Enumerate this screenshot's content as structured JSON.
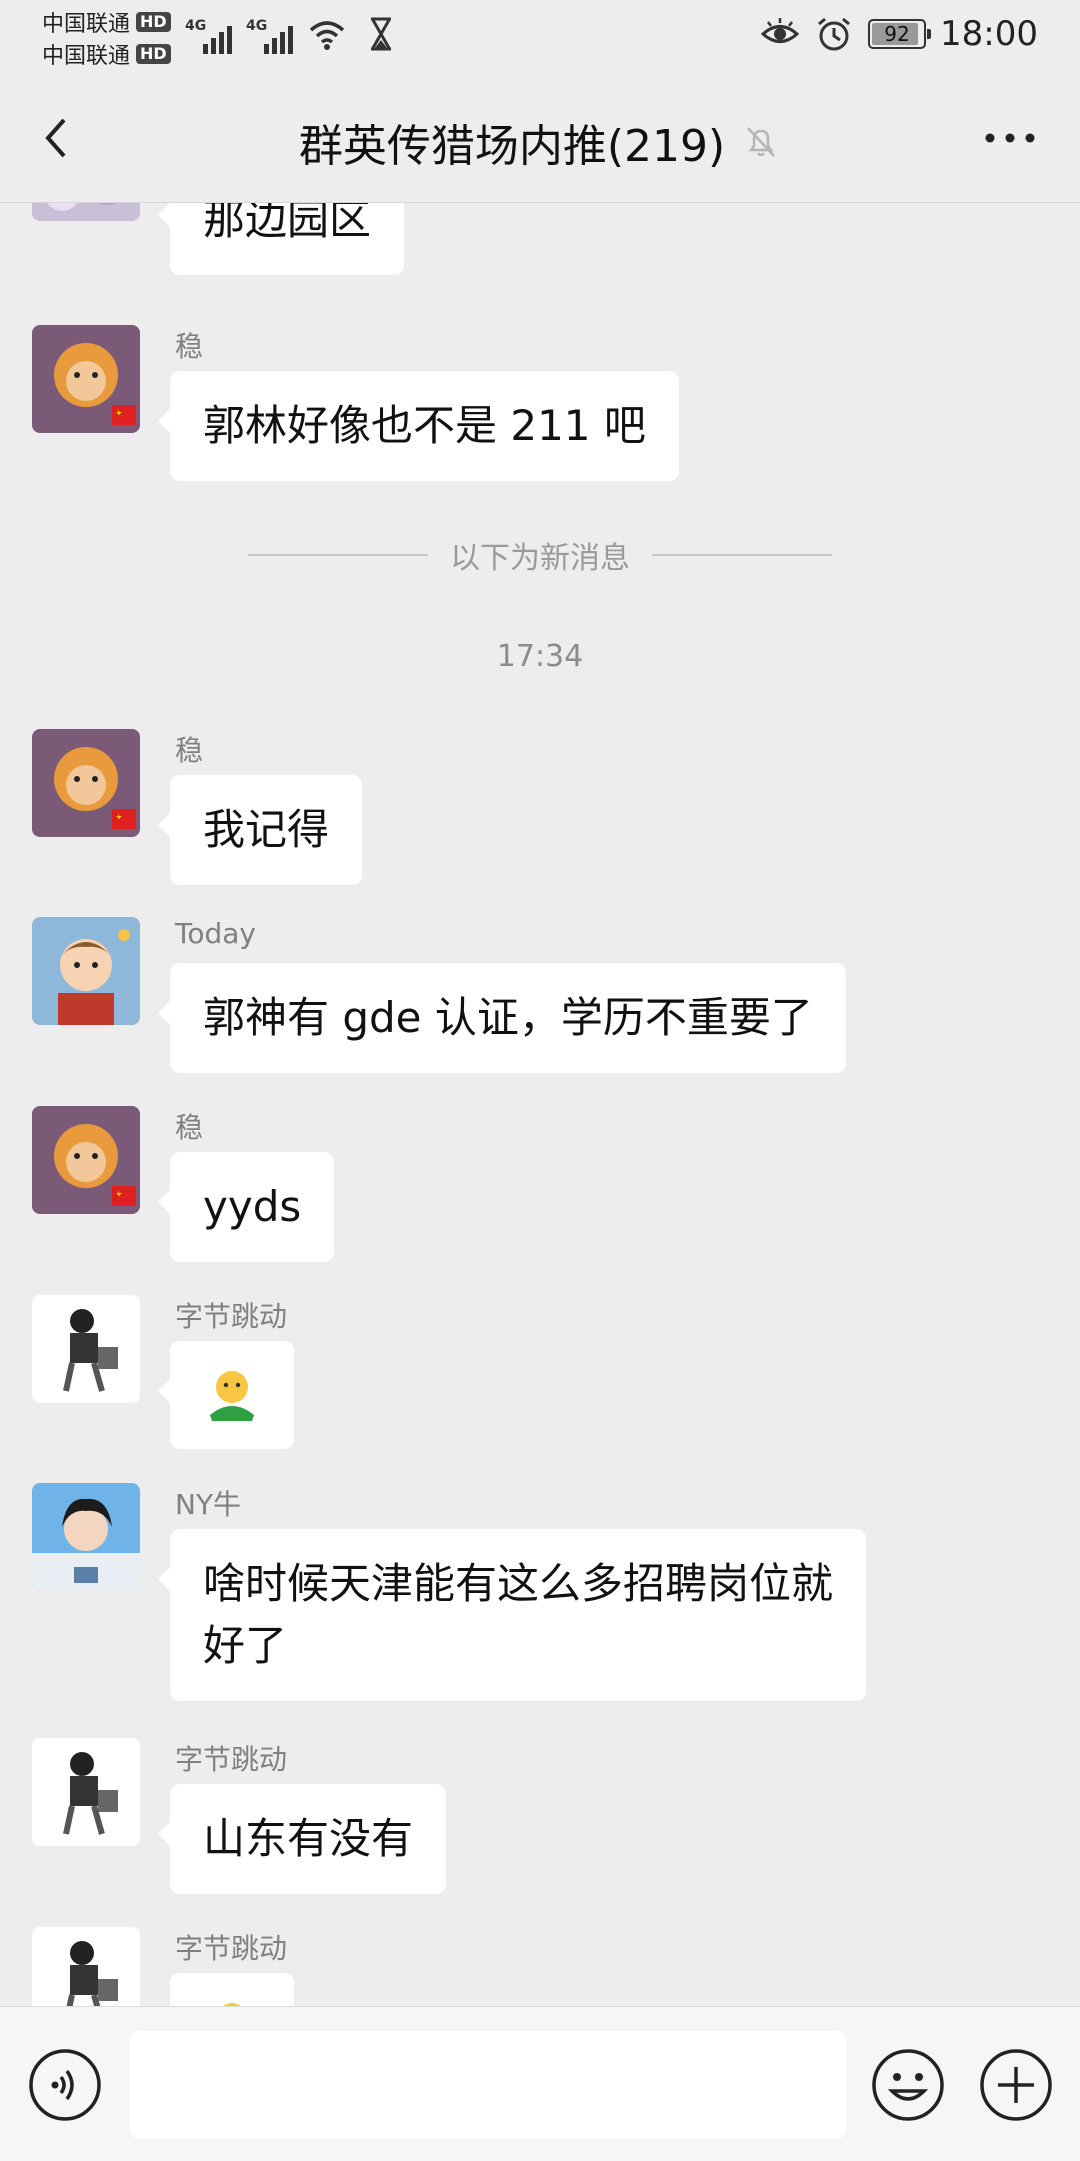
{
  "status_bar": {
    "carrier_1": "中国联通",
    "carrier_2": "中国联通",
    "hd": "HD",
    "network_1": "4G",
    "network_2": "4G",
    "battery_level": "92",
    "battery_fraction": 0.92,
    "time": "18:00"
  },
  "header": {
    "title": "群英传猎场内推(219)",
    "back_icon": "back-arrow",
    "mute_icon": "bell-muted",
    "more_icon": "more-dots"
  },
  "chat": {
    "new_messages_divider": "以下为新消息",
    "timestamp": "17:34",
    "messages": [
      {
        "sender": "",
        "text": "那边园区"
      },
      {
        "sender": "稳",
        "text": "郭林好像也不是 211 吧"
      },
      {
        "sender": "稳",
        "text": "我记得"
      },
      {
        "sender": "Today",
        "text": "郭神有 gde 认证，学历不重要了"
      },
      {
        "sender": "稳",
        "text": "yyds"
      },
      {
        "sender": "字节跳动",
        "text": "",
        "sticker": "green-shirt-emoji"
      },
      {
        "sender": "NY牛",
        "text_line1": "啥时候天津能有这么多招聘岗位就",
        "text_line2": "好了"
      },
      {
        "sender": "字节跳动",
        "text": "山东有没有"
      },
      {
        "sender": "字节跳动",
        "text": "",
        "sticker": "emoji"
      }
    ]
  },
  "input_bar": {
    "voice_icon": "voice",
    "emoji_icon": "smiley",
    "plus_icon": "plus-circle",
    "value": ""
  },
  "colors": {
    "background": "#ededed",
    "bubble": "#ffffff",
    "secondary_text": "#808080"
  }
}
